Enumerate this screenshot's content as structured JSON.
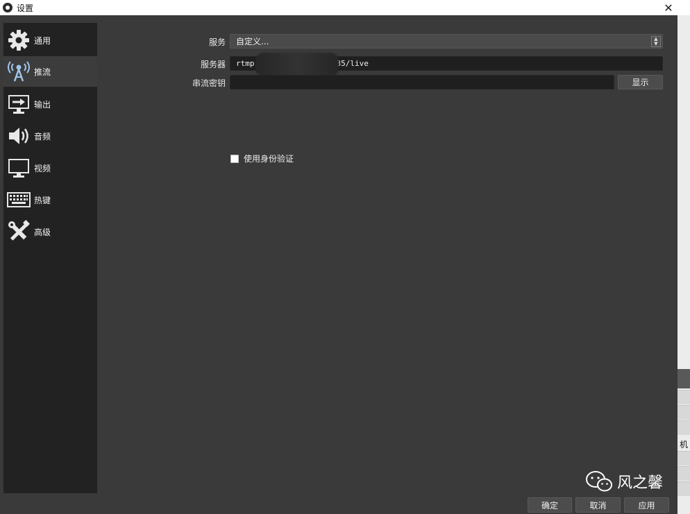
{
  "window": {
    "title": "设置",
    "close_glyph": "✕"
  },
  "sidebar": {
    "items": [
      {
        "label": "通用",
        "icon": "gear-icon"
      },
      {
        "label": "推流",
        "icon": "broadcast-antenna-icon",
        "active": true
      },
      {
        "label": "输出",
        "icon": "output-monitor-icon"
      },
      {
        "label": "音频",
        "icon": "speaker-icon"
      },
      {
        "label": "视频",
        "icon": "monitor-icon"
      },
      {
        "label": "热键",
        "icon": "keyboard-icon"
      },
      {
        "label": "高级",
        "icon": "tools-icon"
      }
    ]
  },
  "stream": {
    "service_label": "服务",
    "service_value": "自定义...",
    "server_label": "服务器",
    "server_value_start": "rtmp",
    "server_value_end": "35/live",
    "key_label": "串流密钥",
    "key_value": "",
    "show_button": "显示",
    "auth_checkbox_label": "使用身份验证",
    "auth_checked": false
  },
  "footer": {
    "ok": "确定",
    "cancel": "取消",
    "apply": "应用"
  },
  "background_partial": {
    "right_edge_char": "机"
  },
  "watermark": {
    "text": "风之馨",
    "icon": "wechat-icon"
  }
}
